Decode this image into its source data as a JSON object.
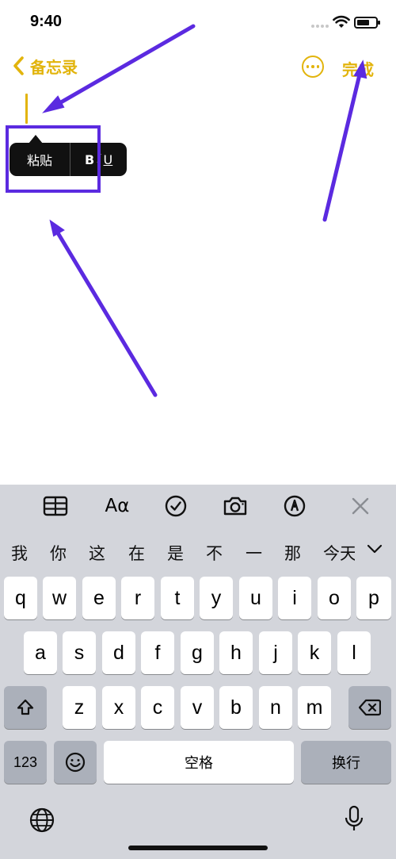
{
  "status_bar": {
    "time": "9:40",
    "icons": [
      "signal-dots-icon",
      "wifi-icon",
      "battery-icon"
    ],
    "battery_level": 0.7
  },
  "nav": {
    "back_label": "备忘录",
    "more_icon": "ellipsis-circle-icon",
    "done_label": "完成"
  },
  "edit_menu": {
    "paste_label": "粘贴",
    "bold_label": "B",
    "italic_label": "I",
    "underline_label": "U"
  },
  "keyboard": {
    "toolbar_icons": [
      "table-icon",
      "text-format-icon",
      "checklist-icon",
      "camera-icon",
      "markup-icon",
      "close-icon"
    ],
    "toolbar_text_format_label": "Aα",
    "candidates": [
      "我",
      "你",
      "这",
      "在",
      "是",
      "不",
      "一",
      "那",
      "今天"
    ],
    "row1": [
      "q",
      "w",
      "e",
      "r",
      "t",
      "y",
      "u",
      "i",
      "o",
      "p"
    ],
    "row2": [
      "a",
      "s",
      "d",
      "f",
      "g",
      "h",
      "j",
      "k",
      "l"
    ],
    "row3": [
      "z",
      "x",
      "c",
      "v",
      "b",
      "n",
      "m"
    ],
    "numbers_label": "123",
    "space_label": "空格",
    "return_label": "换行"
  },
  "colors": {
    "accent": "#e2b40c",
    "annotation": "#5b2ae0",
    "keyboard_bg": "#d3d5db",
    "key_bg": "#ffffff",
    "function_key_bg": "#abb0ba"
  }
}
